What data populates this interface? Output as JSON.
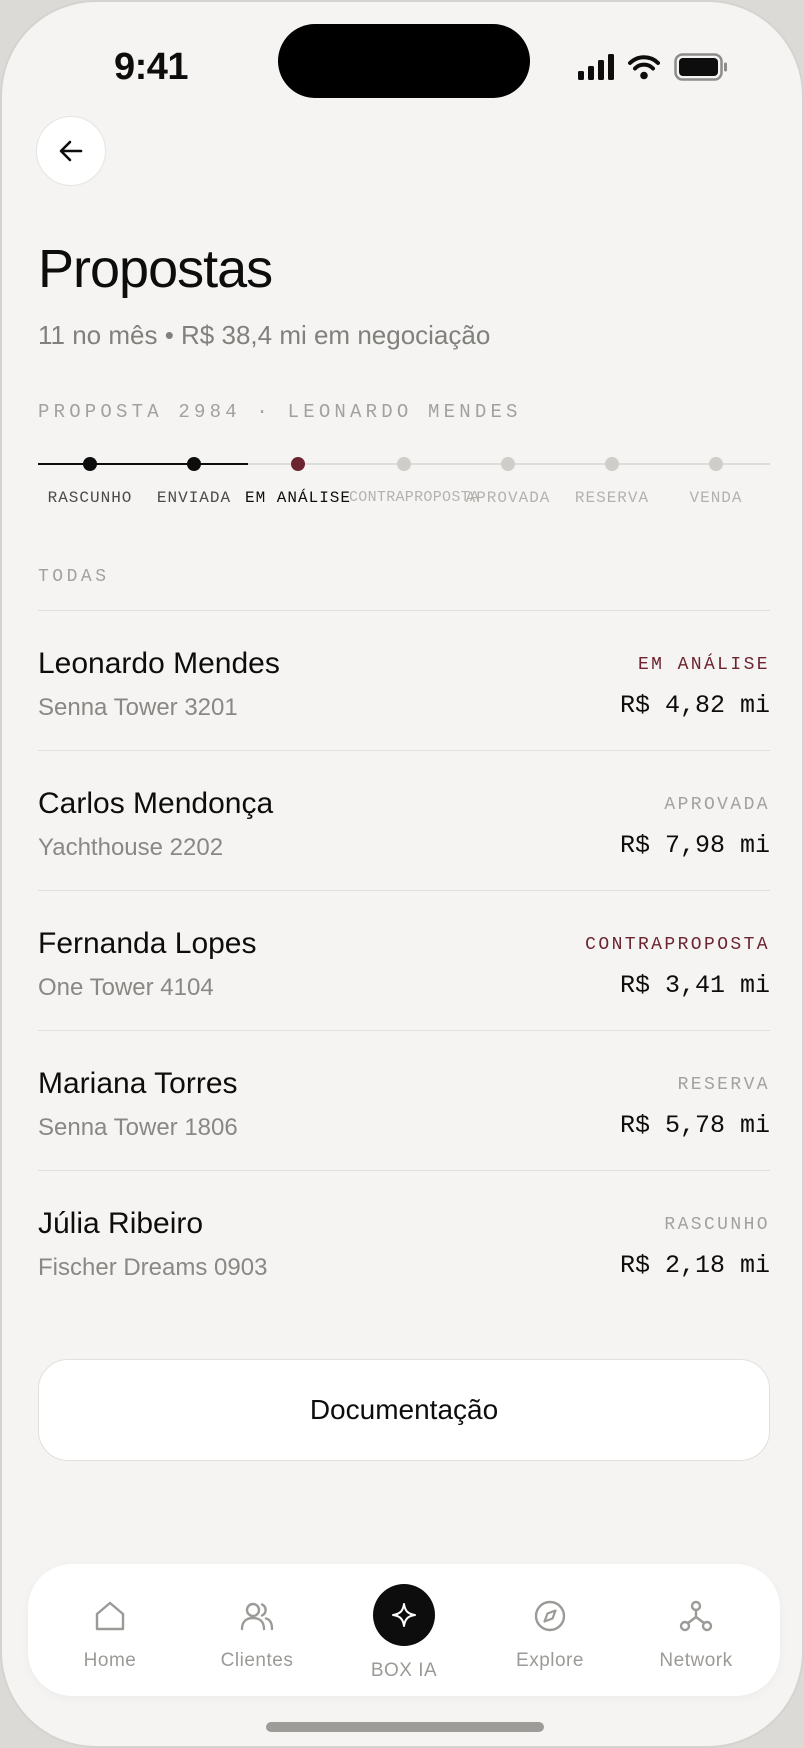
{
  "status_bar": {
    "time": "9:41"
  },
  "header": {
    "title": "Propostas",
    "subtitle": "11 no mês • R$ 38,4 mi em negociação"
  },
  "proposal_ref": "PROPOSTA 2984 · LEONARDO MENDES",
  "stepper": {
    "steps": [
      {
        "label": "RASCUNHO",
        "state": "done"
      },
      {
        "label": "ENVIADA",
        "state": "done"
      },
      {
        "label": "EM ANÁLISE",
        "state": "current"
      },
      {
        "label": "CONTRAPROPOSTA",
        "state": "pending"
      },
      {
        "label": "APROVADA",
        "state": "pending"
      },
      {
        "label": "RESERVA",
        "state": "pending"
      },
      {
        "label": "VENDA",
        "state": "pending"
      }
    ]
  },
  "section_label": "TODAS",
  "proposals": [
    {
      "name": "Leonardo Mendes",
      "unit": "Senna Tower 3201",
      "status": "EM ANÁLISE",
      "price": "R$ 4,82 mi"
    },
    {
      "name": "Carlos Mendonça",
      "unit": "Yachthouse 2202",
      "status": "APROVADA",
      "price": "R$ 7,98 mi"
    },
    {
      "name": "Fernanda Lopes",
      "unit": "One Tower 4104",
      "status": "CONTRAPROPOSTA",
      "price": "R$ 3,41 mi"
    },
    {
      "name": "Mariana Torres",
      "unit": "Senna Tower 1806",
      "status": "RESERVA",
      "price": "R$ 5,78 mi"
    },
    {
      "name": "Júlia Ribeiro",
      "unit": "Fischer Dreams 0903",
      "status": "RASCUNHO",
      "price": "R$ 2,18 mi"
    }
  ],
  "doc_button": "Documentação",
  "tabbar": {
    "home": "Home",
    "clientes": "Clientes",
    "box_ia": "BOX IA",
    "explore": "Explore",
    "network": "Network"
  },
  "colors": {
    "accent": "#6b2430",
    "background": "#f5f4f2",
    "text": "#0d0d0d",
    "muted": "#8a8884"
  },
  "icons": [
    "back-arrow-icon",
    "signal-icon",
    "wifi-icon",
    "battery-icon",
    "home-icon",
    "users-icon",
    "sparkle-icon",
    "compass-icon",
    "network-icon"
  ]
}
